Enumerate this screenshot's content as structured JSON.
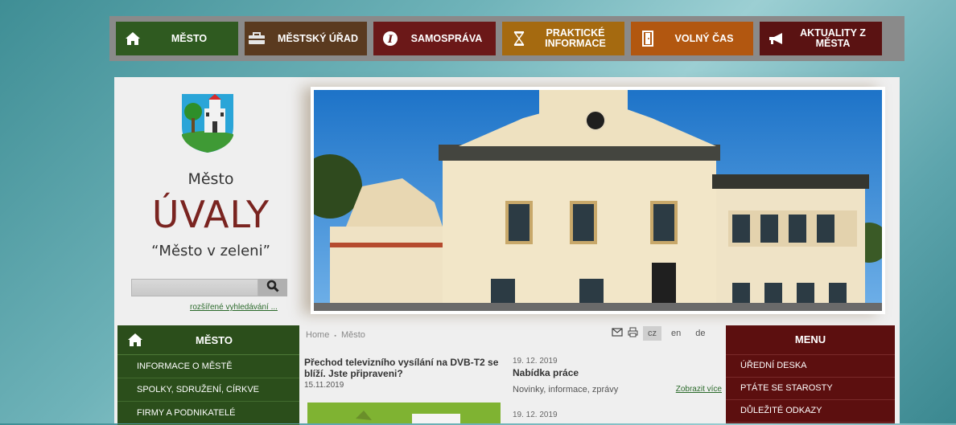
{
  "topnav": [
    {
      "label": "MĚSTO",
      "icon": "home-icon"
    },
    {
      "label": "MĚSTSKÝ ÚŘAD",
      "icon": "briefcase-icon"
    },
    {
      "label": "SAMOSPRÁVA",
      "icon": "info-icon"
    },
    {
      "label": "PRAKTICKÉ INFORMACE",
      "icon": "hourglass-icon"
    },
    {
      "label": "VOLNÝ ČAS",
      "icon": "door-icon"
    },
    {
      "label": "AKTUALITY Z MĚSTA",
      "icon": "megaphone-icon"
    }
  ],
  "branding": {
    "small": "Město",
    "big": "ÚVALY",
    "motto": "“Město v zeleni”"
  },
  "search": {
    "placeholder": "",
    "advanced_link": "rozšířené vyhledávání ..."
  },
  "left_menu": {
    "title": "MĚSTO",
    "items": [
      "INFORMACE O MĚSTĚ",
      "SPOLKY, SDRUŽENÍ, CÍRKVE",
      "FIRMY A PODNIKATELÉ"
    ]
  },
  "breadcrumb": {
    "home": "Home",
    "sep": "▪",
    "current": "Město"
  },
  "languages": {
    "cz": "cz",
    "en": "en",
    "de": "de"
  },
  "news_left": {
    "title": "Přechod televizního vysílání na DVB-T2 se blíží. Jste připraveni?",
    "date": "15.11.2019"
  },
  "news_right": [
    {
      "date": "19. 12. 2019",
      "title": "Nabídka práce",
      "category": "Novinky, informace, zprávy",
      "more": "Zobrazit více"
    },
    {
      "date": "19. 12. 2019"
    }
  ],
  "right_menu": {
    "title": "MENU",
    "items": [
      "ÚŘEDNÍ DESKA",
      "PTÁTE SE STAROSTY",
      "DŮLEŽITÉ ODKAZY"
    ]
  },
  "colors": {
    "nav_mesto": "#2f5a20",
    "nav_urad": "#5a3a1f",
    "nav_samosprava": "#6b1818",
    "nav_prakticke": "#a56a10",
    "nav_volny": "#b25710",
    "nav_aktuality": "#5a1212",
    "left_menu": "#2b4e1b",
    "right_menu": "#5c0f0f",
    "brand_text": "#7a2420"
  }
}
